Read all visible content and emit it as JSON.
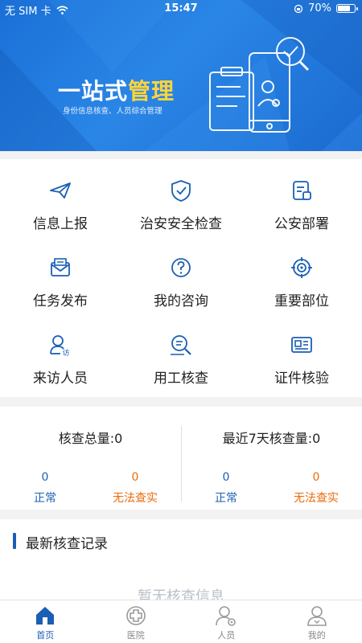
{
  "status_bar": {
    "carrier": "无 SIM 卡",
    "time": "15:47",
    "battery": "70%"
  },
  "banner": {
    "title_part1": "一站式",
    "title_part2": "管理",
    "subtitle": "身份信息核查、人员综合管理"
  },
  "grid": {
    "items": [
      {
        "label": "信息上报",
        "icon": "paper-plane-icon"
      },
      {
        "label": "治安安全检查",
        "icon": "shield-check-icon"
      },
      {
        "label": "公安部署",
        "icon": "clipboard-icon"
      },
      {
        "label": "任务发布",
        "icon": "envelope-icon"
      },
      {
        "label": "我的咨询",
        "icon": "question-icon"
      },
      {
        "label": "重要部位",
        "icon": "target-icon"
      },
      {
        "label": "来访人员",
        "icon": "visitor-icon"
      },
      {
        "label": "用工核查",
        "icon": "search-doc-icon"
      },
      {
        "label": "证件核验",
        "icon": "id-card-icon"
      }
    ]
  },
  "stats": {
    "total": {
      "title": "核查总量:0",
      "normal_value": "0",
      "normal_label": "正常",
      "fail_value": "0",
      "fail_label": "无法查实"
    },
    "recent": {
      "title": "最近7天核查量:0",
      "normal_value": "0",
      "normal_label": "正常",
      "fail_value": "0",
      "fail_label": "无法查实"
    }
  },
  "records": {
    "title": "最新核查记录",
    "empty_text": "暂无核查信息"
  },
  "tabbar": {
    "tabs": [
      {
        "label": "首页",
        "icon": "home-icon",
        "active": true
      },
      {
        "label": "医院",
        "icon": "hospital-icon",
        "active": false
      },
      {
        "label": "人员",
        "icon": "staff-icon",
        "active": false
      },
      {
        "label": "我的",
        "icon": "profile-icon",
        "active": false
      }
    ]
  },
  "colors": {
    "primary": "#1a5fb4",
    "accent": "#ffd43b",
    "warning": "#ea6a0c",
    "banner": "#2a86e6"
  }
}
